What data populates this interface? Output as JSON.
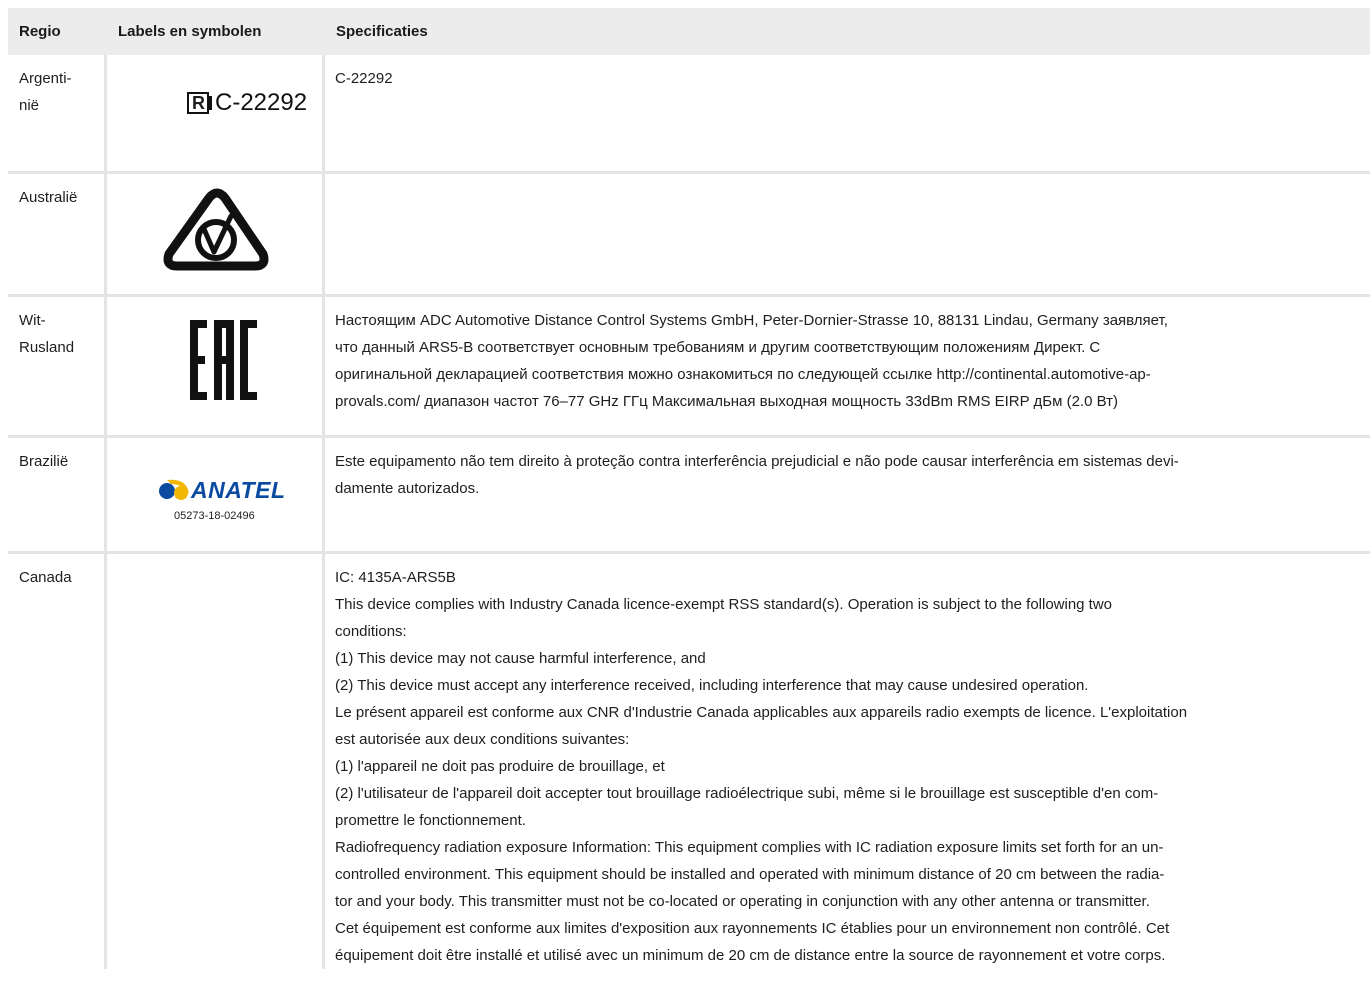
{
  "table": {
    "headers": [
      "Regio",
      "Labels en symbolen",
      "Specificaties"
    ]
  },
  "rows": [
    {
      "region": "Argenti-\nnië",
      "label": {
        "icon": "rcm-r-mark-icon",
        "text": "C-22292"
      },
      "spec": [
        "C-22292"
      ]
    },
    {
      "region": "Australië",
      "label": {
        "icon": "rcm-compliance-mark-icon"
      },
      "spec": []
    },
    {
      "region": "Wit-\nRusland",
      "label": {
        "icon": "eac-mark-icon"
      },
      "spec": [
        "Настоящим ADC Automotive Distance Control Systems GmbH, Peter-Dornier-Strasse 10, 88131 Lindau, Germany заявляет,",
        "что данный ARS5-B соответствует основным требованиям и другим соответствующим положениям Директ. С",
        "оригинальной декларацией соответствия можно ознакомиться по следующей ссылке http://continental.automotive-ap-",
        "provals.com/ диапазон частот 76–77 GHz ГГц Максимальная выходная мощность 33dBm RMS EIRP дБм (2.0 Вт)"
      ]
    },
    {
      "region": "Brazilië",
      "label": {
        "icon": "anatel-logo-icon",
        "text": "ANATEL",
        "number": "05273-18-02496"
      },
      "spec": [
        "Este equipamento não tem direito à proteção contra interferência prejudicial e não pode causar interferência em sistemas devi-",
        "damente autorizados."
      ]
    },
    {
      "region": "Canada",
      "label": {},
      "spec": [
        "IC: 4135A-ARS5B",
        "This device complies with Industry Canada licence-exempt RSS standard(s). Operation is subject to the following two",
        "conditions:",
        "(1) This device may not cause harmful interference, and",
        "(2) This device must accept any interference received, including interference that may cause undesired operation.",
        "Le présent appareil est conforme aux CNR d'Industrie Canada applicables aux appareils radio exempts de licence. L'exploitation",
        "est autorisée aux deux conditions suivantes:",
        "(1) l'appareil ne doit pas produire de brouillage, et",
        "(2) l'utilisateur de l'appareil doit accepter tout brouillage radioélectrique subi, même si le brouillage est susceptible d'en com-",
        "promettre le fonctionnement.",
        "Radiofrequency radiation exposure Information: This equipment complies with IC radiation exposure limits set forth for an un-",
        "controlled environment. This equipment should be installed and operated with minimum distance of 20 cm between the radia-",
        "tor and your body. This transmitter must not be co-located or operating in conjunction with any other antenna or transmitter.",
        "Cet équipement est conforme aux limites d'exposition aux rayonnements IC établies pour un environnement non contrôlé. Cet",
        "équipement doit être installé et utilisé avec un minimum de 20 cm de distance entre la source de rayonnement et votre corps."
      ]
    }
  ]
}
